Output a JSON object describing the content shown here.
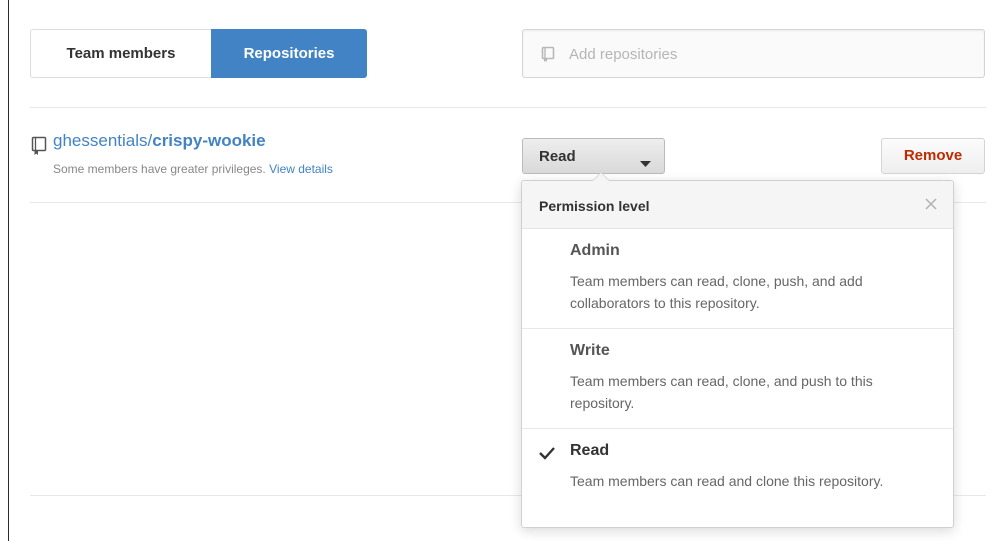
{
  "tabs": [
    {
      "label": "Team members",
      "active": false
    },
    {
      "label": "Repositories",
      "active": true
    }
  ],
  "add_repo": {
    "placeholder": "Add repositories",
    "icon": "repo-icon"
  },
  "repo": {
    "owner": "ghessentials/",
    "name": "crispy-wookie",
    "note": "Some members have greater privileges.",
    "note_link": "View details"
  },
  "permission_button": {
    "label": "Read",
    "icon": "caret-down-icon"
  },
  "remove_button": {
    "label": "Remove"
  },
  "dropdown": {
    "title": "Permission level",
    "options": [
      {
        "title": "Admin",
        "desc": "Team members can read, clone, push, and add collaborators to this repository.",
        "selected": false
      },
      {
        "title": "Write",
        "desc": "Team members can read, clone, and push to this repository.",
        "selected": false
      },
      {
        "title": "Read",
        "desc": "Team members can read and clone this repository.",
        "selected": true
      }
    ]
  },
  "colors": {
    "accent": "#4183c4",
    "danger": "#bd2c00",
    "muted": "#888888"
  }
}
